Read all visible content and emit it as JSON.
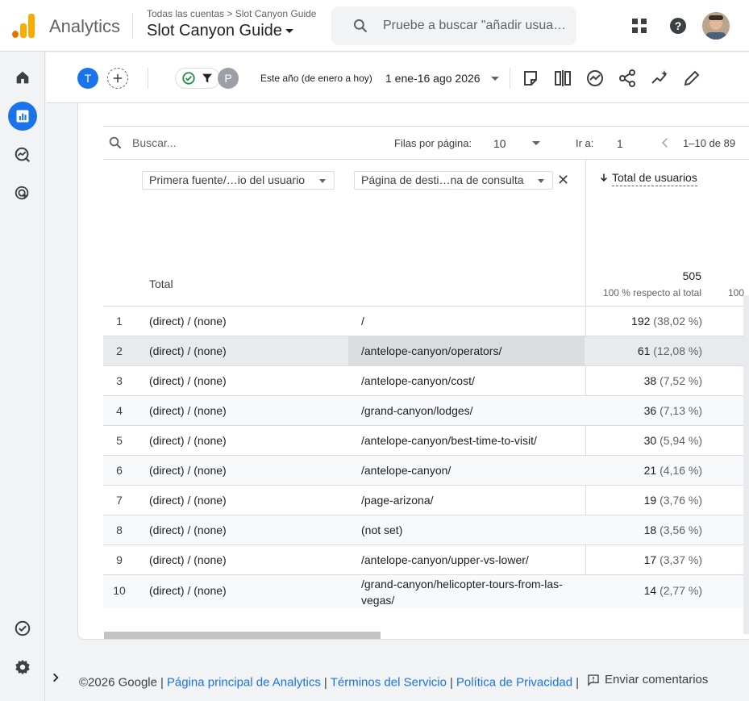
{
  "header": {
    "product": "Analytics",
    "breadcrumb": "Todas las cuentas > Slot Canyon Guide",
    "property": "Slot Canyon Guide",
    "search_placeholder": "Pruebe a buscar \"añadir usua…"
  },
  "toolbar": {
    "comparison_letter": "T",
    "filter_letter": "P",
    "date_label": "Este año (de enero a hoy)",
    "date_range": "1 ene-16 ago 2026"
  },
  "table": {
    "search_placeholder": "Buscar...",
    "rows_per_page_label": "Filas por página:",
    "rows_per_page_value": "10",
    "goto_label": "Ir a:",
    "goto_value": "1",
    "pagination": "1–10 de 89",
    "dimension_1": "Primera fuente/…io del usuario",
    "dimension_2": "Página de desti…na de consulta",
    "metric_header": "Total de usuarios",
    "total_label": "Total",
    "total_value": "505",
    "total_pct": "100 % respecto al total",
    "total_pct_next": "100",
    "rows": [
      {
        "idx": "1",
        "source": "(direct) / (none)",
        "page": "/",
        "value": "192",
        "pct": "(38,02 %)"
      },
      {
        "idx": "2",
        "source": "(direct) / (none)",
        "page": "/antelope-canyon/operators/",
        "value": "61",
        "pct": "(12,08 %)"
      },
      {
        "idx": "3",
        "source": "(direct) / (none)",
        "page": "/antelope-canyon/cost/",
        "value": "38",
        "pct": "(7,52 %)"
      },
      {
        "idx": "4",
        "source": "(direct) / (none)",
        "page": "/grand-canyon/lodges/",
        "value": "36",
        "pct": "(7,13 %)"
      },
      {
        "idx": "5",
        "source": "(direct) / (none)",
        "page": "/antelope-canyon/best-time-to-visit/",
        "value": "30",
        "pct": "(5,94 %)"
      },
      {
        "idx": "6",
        "source": "(direct) / (none)",
        "page": "/antelope-canyon/",
        "value": "21",
        "pct": "(4,16 %)"
      },
      {
        "idx": "7",
        "source": "(direct) / (none)",
        "page": "/page-arizona/",
        "value": "19",
        "pct": "(3,76 %)"
      },
      {
        "idx": "8",
        "source": "(direct) / (none)",
        "page": "(not set)",
        "value": "18",
        "pct": "(3,56 %)"
      },
      {
        "idx": "9",
        "source": "(direct) / (none)",
        "page": "/antelope-canyon/upper-vs-lower/",
        "value": "17",
        "pct": "(3,37 %)"
      },
      {
        "idx": "10",
        "source": "(direct) / (none)",
        "page": "/grand-canyon/helicopter-tours-from-las-vegas/",
        "value": "14",
        "pct": "(2,77 %)"
      }
    ]
  },
  "footer": {
    "copyright": "©2026 Google",
    "link_home": "Página principal de Analytics",
    "link_terms": "Términos del Servicio",
    "link_privacy": "Política de Privacidad",
    "feedback": "Enviar comentarios"
  },
  "colors": {
    "accent": "#1a73e8",
    "logo_orange": "#f9ab00",
    "logo_dark": "#e37400",
    "filter_check": "#1e8e3e"
  },
  "icons": [
    "apps-icon",
    "help-icon",
    "home-icon",
    "reports-icon",
    "explore-icon",
    "advertising-icon",
    "admin-icon",
    "settings-icon"
  ]
}
